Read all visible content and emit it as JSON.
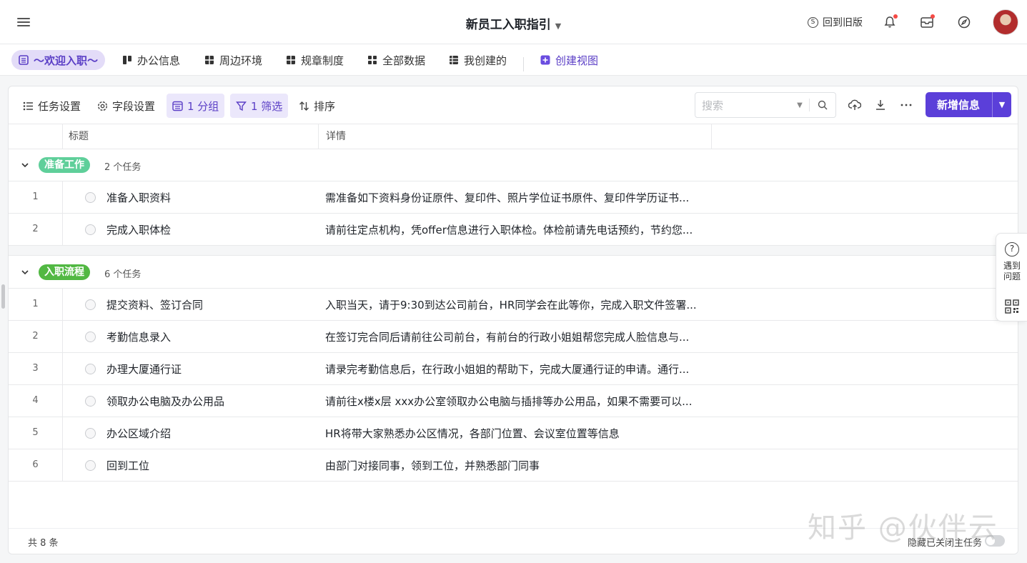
{
  "header": {
    "title": "新员工入职指引",
    "old_version": "回到旧版"
  },
  "views": [
    {
      "label": "～欢迎入职～",
      "icon": "list-icon"
    },
    {
      "label": "办公信息",
      "icon": "kanban-icon"
    },
    {
      "label": "周边环境",
      "icon": "table-icon"
    },
    {
      "label": "规章制度",
      "icon": "table-icon"
    },
    {
      "label": "全部数据",
      "icon": "grid-icon"
    },
    {
      "label": "我创建的",
      "icon": "table-icon"
    },
    {
      "label": "创建视图",
      "icon": "plus-square-icon"
    }
  ],
  "toolbar": {
    "task_settings": "任务设置",
    "field_settings": "字段设置",
    "group": "1 分组",
    "filter": "1 筛选",
    "sort": "排序",
    "search_placeholder": "搜索",
    "add_button": "新增信息"
  },
  "columns": [
    "标题",
    "详情"
  ],
  "groups": [
    {
      "name": "准备工作",
      "count": "2 个任务",
      "color": "#5fcf9a",
      "rows": [
        {
          "idx": "1",
          "title": "准备入职资料",
          "detail": "需准备如下资料身份证原件、复印件、照片学位证书原件、复印件学历证书..."
        },
        {
          "idx": "2",
          "title": "完成入职体检",
          "detail": "请前往定点机构，凭offer信息进行入职体检。体检前请先电话预约，节约您..."
        }
      ]
    },
    {
      "name": "入职流程",
      "count": "6 个任务",
      "color": "#52b843",
      "rows": [
        {
          "idx": "1",
          "title": "提交资料、签订合同",
          "detail": "入职当天，请于9:30到达公司前台，HR同学会在此等你，完成入职文件签署..."
        },
        {
          "idx": "2",
          "title": "考勤信息录入",
          "detail": "在签订完合同后请前往公司前台，有前台的行政小姐姐帮您完成人脸信息与..."
        },
        {
          "idx": "3",
          "title": "办理大厦通行证",
          "detail": "请录完考勤信息后，在行政小姐姐的帮助下，完成大厦通行证的申请。通行..."
        },
        {
          "idx": "4",
          "title": "领取办公电脑及办公用品",
          "detail": "请前往x楼x层 xxx办公室领取办公电脑与插排等办公用品，如果不需要可以..."
        },
        {
          "idx": "5",
          "title": "办公区域介绍",
          "detail": "HR将带大家熟悉办公区情况，各部门位置、会议室位置等信息"
        },
        {
          "idx": "6",
          "title": "回到工位",
          "detail": "由部门对接同事，领到工位，并熟悉部门同事"
        }
      ]
    }
  ],
  "footer": {
    "total": "共 8 条",
    "hide_closed": "隐藏已关闭主任务"
  },
  "help": {
    "label": "遇到问题"
  },
  "watermark": "知乎 @伙伴云"
}
